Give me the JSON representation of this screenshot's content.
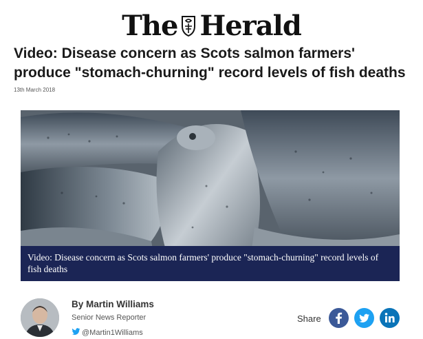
{
  "masthead": {
    "name_left": "The",
    "name_right": "Herald"
  },
  "article": {
    "headline": "Video: Disease concern as Scots salmon farmers' produce \"stomach-churning\" record levels of fish deaths",
    "date": "13th March 2018"
  },
  "media": {
    "caption": "Video: Disease concern as Scots salmon farmers' produce \"stomach-churning\" record levels of fish deaths"
  },
  "author": {
    "name": "By Martin Williams",
    "role": "Senior News Reporter",
    "handle": "@Martin1Williams"
  },
  "share": {
    "label": "Share",
    "buttons": [
      {
        "icon": "facebook-icon",
        "color": "#3b5998"
      },
      {
        "icon": "twitter-icon",
        "color": "#1da1f2"
      },
      {
        "icon": "linkedin-icon",
        "color": "#0a74b8"
      }
    ]
  },
  "colors": {
    "caption_bg": "#1b2555",
    "text": "#1a1a1a"
  }
}
